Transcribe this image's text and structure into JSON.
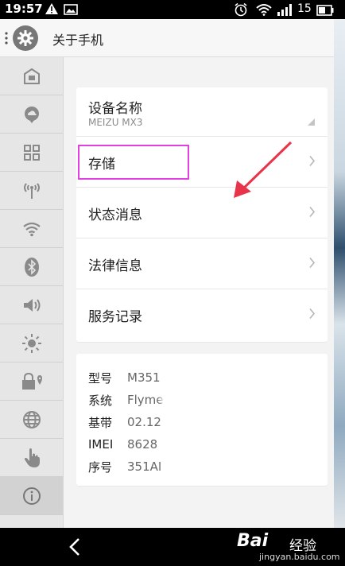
{
  "status_bar": {
    "time": "19:57",
    "battery_level": "15"
  },
  "header": {
    "title": "关于手机"
  },
  "sidebar": {
    "items": [
      {
        "icon": "home-icon"
      },
      {
        "icon": "cloud-icon"
      },
      {
        "icon": "apps-grid-icon"
      },
      {
        "icon": "antenna-icon"
      },
      {
        "icon": "wifi-icon"
      },
      {
        "icon": "bluetooth-icon"
      },
      {
        "icon": "volume-icon"
      },
      {
        "icon": "brightness-icon"
      },
      {
        "icon": "lock-location-icon"
      },
      {
        "icon": "globe-icon"
      },
      {
        "icon": "hand-icon"
      },
      {
        "icon": "info-icon",
        "active": true
      }
    ]
  },
  "menu": {
    "device_name_label": "设备名称",
    "device_name_value": "MEIZU MX3",
    "storage": "存储",
    "status": "状态消息",
    "legal": "法律信息",
    "service": "服务记录"
  },
  "info": {
    "rows": [
      {
        "key": "型号",
        "value": "M351"
      },
      {
        "key": "系统",
        "value": "Flyme"
      },
      {
        "key": "基带",
        "value": "02.12"
      },
      {
        "key": "IMEI",
        "value": "8628"
      },
      {
        "key": "序号",
        "value": "351AI"
      }
    ]
  },
  "watermark": {
    "brand": "Bai",
    "name": "经验",
    "url": "jingyan.baidu.com"
  },
  "colors": {
    "highlight": "#e040e0",
    "arrow": "#e8344a"
  }
}
